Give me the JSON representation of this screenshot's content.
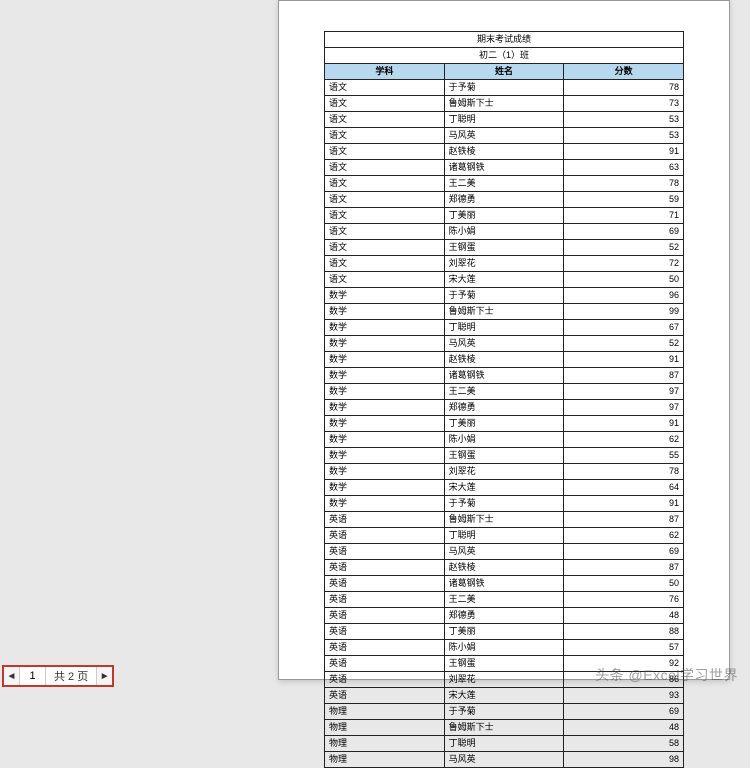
{
  "report": {
    "title": "期末考试成绩",
    "class": "初二（1）班",
    "columns": {
      "subject": "学科",
      "name": "姓名",
      "score": "分数"
    },
    "rows": [
      {
        "s": "语文",
        "n": "于予菊",
        "v": 78
      },
      {
        "s": "语文",
        "n": "鲁姆斯下士",
        "v": 73
      },
      {
        "s": "语文",
        "n": "丁聪明",
        "v": 53
      },
      {
        "s": "语文",
        "n": "马风英",
        "v": 53
      },
      {
        "s": "语文",
        "n": "赵铁棱",
        "v": 91
      },
      {
        "s": "语文",
        "n": "诸葛钢铁",
        "v": 63
      },
      {
        "s": "语文",
        "n": "王二美",
        "v": 78
      },
      {
        "s": "语文",
        "n": "郑德勇",
        "v": 59
      },
      {
        "s": "语文",
        "n": "丁美丽",
        "v": 71
      },
      {
        "s": "语文",
        "n": "陈小娟",
        "v": 69
      },
      {
        "s": "语文",
        "n": "王钢蛋",
        "v": 52
      },
      {
        "s": "语文",
        "n": "刘翠花",
        "v": 72
      },
      {
        "s": "语文",
        "n": "宋大莲",
        "v": 50
      },
      {
        "s": "数学",
        "n": "于予菊",
        "v": 96
      },
      {
        "s": "数学",
        "n": "鲁姆斯下士",
        "v": 99
      },
      {
        "s": "数学",
        "n": "丁聪明",
        "v": 67
      },
      {
        "s": "数学",
        "n": "马风英",
        "v": 52
      },
      {
        "s": "数学",
        "n": "赵铁棱",
        "v": 91
      },
      {
        "s": "数学",
        "n": "诸葛钢铁",
        "v": 87
      },
      {
        "s": "数学",
        "n": "王二美",
        "v": 97
      },
      {
        "s": "数学",
        "n": "郑德勇",
        "v": 97
      },
      {
        "s": "数学",
        "n": "丁美丽",
        "v": 91
      },
      {
        "s": "数学",
        "n": "陈小娟",
        "v": 62
      },
      {
        "s": "数学",
        "n": "王钢蛋",
        "v": 55
      },
      {
        "s": "数学",
        "n": "刘翠花",
        "v": 78
      },
      {
        "s": "数学",
        "n": "宋大莲",
        "v": 64
      },
      {
        "s": "数学",
        "n": "于予菊",
        "v": 91
      },
      {
        "s": "英语",
        "n": "鲁姆斯下士",
        "v": 87
      },
      {
        "s": "英语",
        "n": "丁聪明",
        "v": 62
      },
      {
        "s": "英语",
        "n": "马风英",
        "v": 69
      },
      {
        "s": "英语",
        "n": "赵铁棱",
        "v": 87
      },
      {
        "s": "英语",
        "n": "诸葛钢铁",
        "v": 50
      },
      {
        "s": "英语",
        "n": "王二美",
        "v": 76
      },
      {
        "s": "英语",
        "n": "郑德勇",
        "v": 48
      },
      {
        "s": "英语",
        "n": "丁美丽",
        "v": 88
      },
      {
        "s": "英语",
        "n": "陈小娟",
        "v": 57
      },
      {
        "s": "英语",
        "n": "王钢蛋",
        "v": 92
      },
      {
        "s": "英语",
        "n": "刘翠花",
        "v": 86
      },
      {
        "s": "英语",
        "n": "宋大莲",
        "v": 93
      },
      {
        "s": "物理",
        "n": "于予菊",
        "v": 69
      },
      {
        "s": "物理",
        "n": "鲁姆斯下士",
        "v": 48
      },
      {
        "s": "物理",
        "n": "丁聪明",
        "v": 58
      },
      {
        "s": "物理",
        "n": "马风英",
        "v": 98
      }
    ]
  },
  "pager": {
    "current": "1",
    "total_label": "共 2 页"
  },
  "watermark": "头条 @Excel学习世界"
}
